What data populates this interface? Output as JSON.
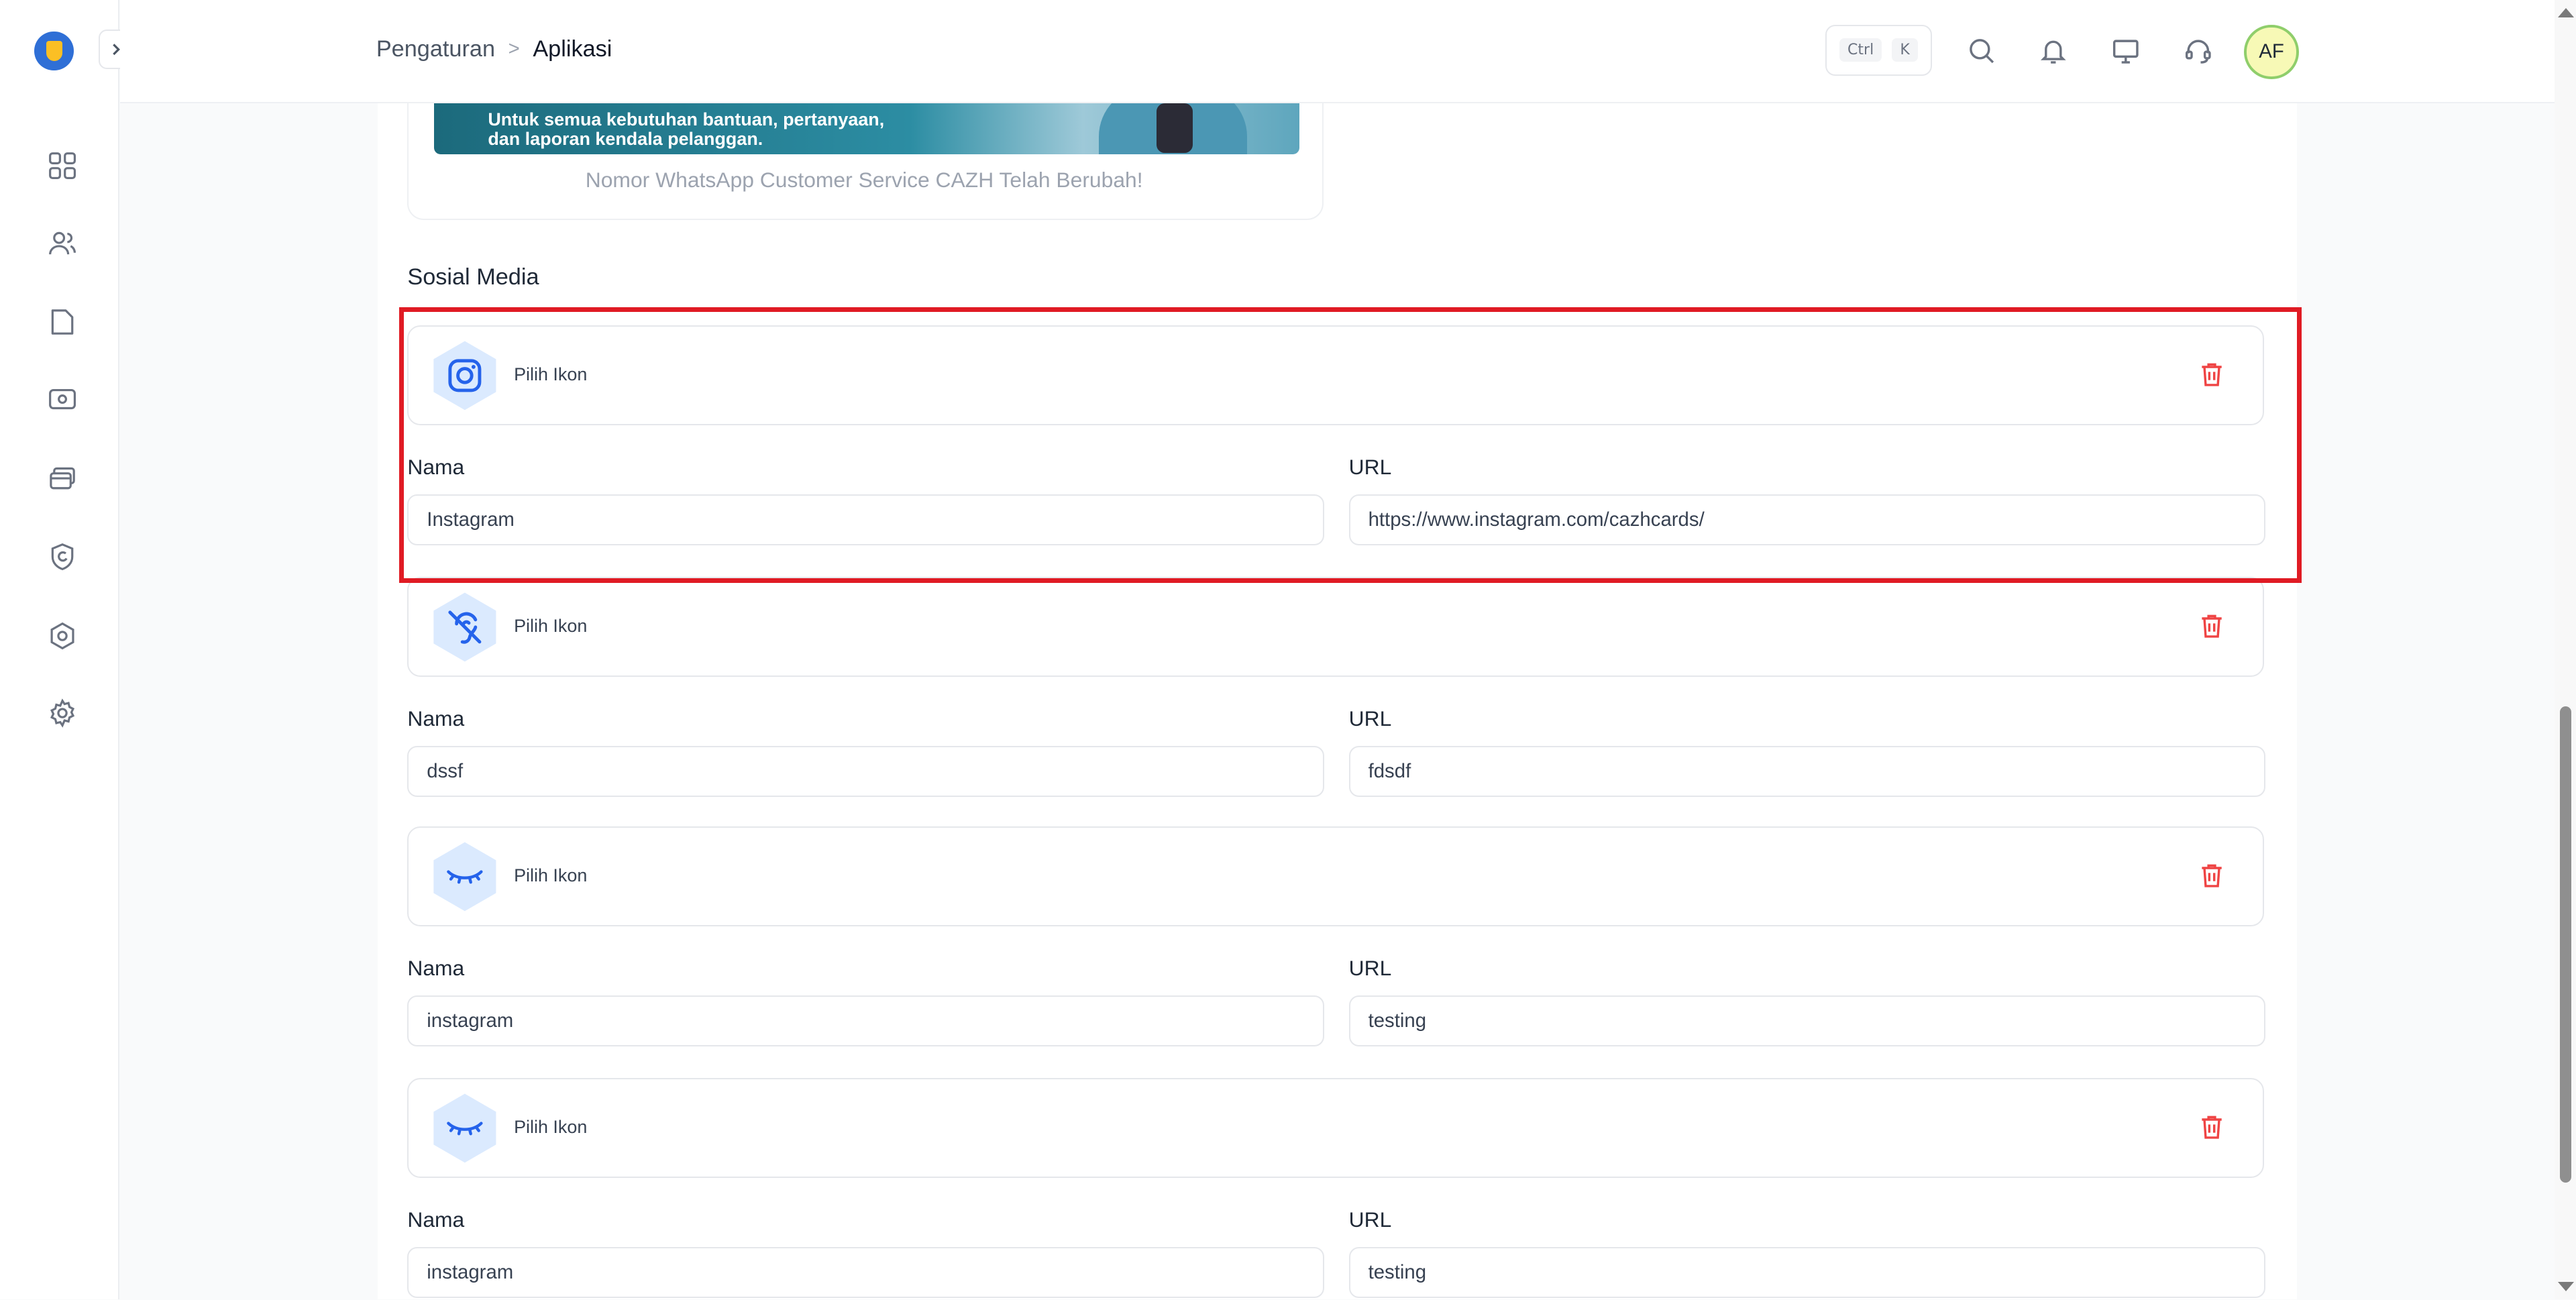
{
  "breadcrumb": {
    "parent": "Pengaturan",
    "separator": ">",
    "current": "Aplikasi"
  },
  "shortcut": {
    "key1": "Ctrl",
    "key2": "K"
  },
  "user": {
    "initials": "AF"
  },
  "banner": {
    "line1": "Untuk semua kebutuhan bantuan, pertanyaan,",
    "line2": "dan laporan kendala pelanggan.",
    "caption": "Nomor WhatsApp Customer Service CAZH Telah Berubah!"
  },
  "social": {
    "title": "Sosial Media",
    "pick_label": "Pilih Ikon",
    "name_label": "Nama",
    "url_label": "URL",
    "items": [
      {
        "icon": "instagram-icon",
        "name": "Instagram",
        "url": "https://www.instagram.com/cazhcards/"
      },
      {
        "icon": "ear-off-icon",
        "name": "dssf",
        "url": "fdsdf"
      },
      {
        "icon": "eye-closed-icon",
        "name": "instagram",
        "url": "testing"
      },
      {
        "icon": "eye-closed-icon",
        "name": "instagram",
        "url": "testing"
      }
    ]
  },
  "colors": {
    "accent": "#3b82f6",
    "danger": "#ef4444",
    "highlight": "#e01b24"
  }
}
